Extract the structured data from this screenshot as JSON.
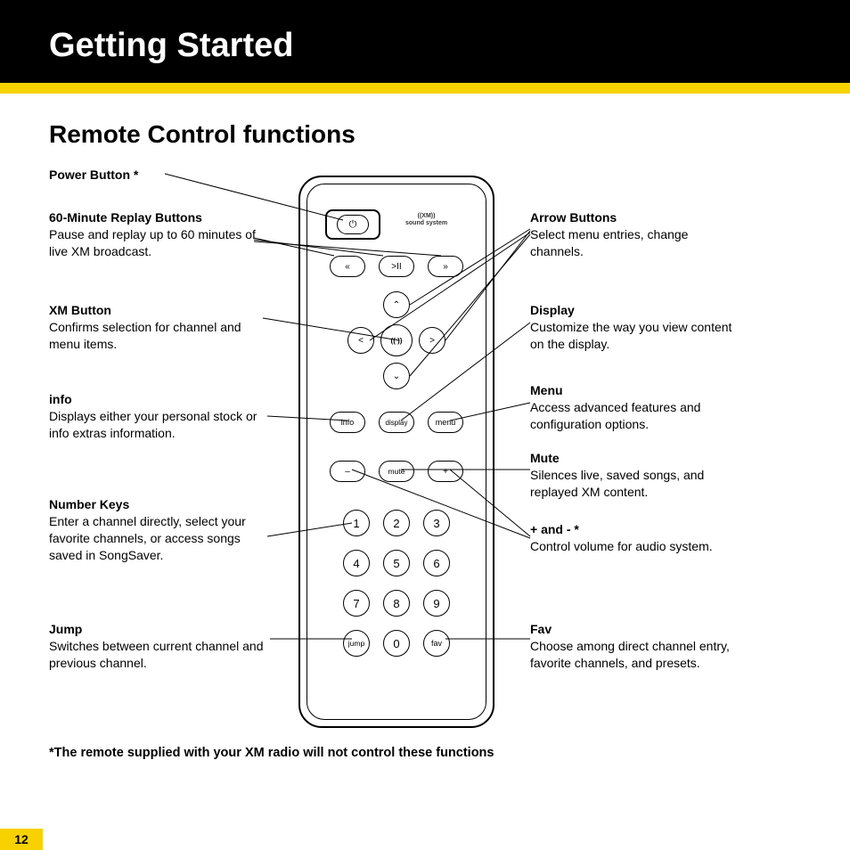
{
  "header": {
    "title": "Getting Started"
  },
  "subtitle": "Remote Control functions",
  "left_labels": [
    {
      "title": "Power Button *",
      "desc": ""
    },
    {
      "title": "60-Minute Replay Buttons",
      "desc": "Pause and replay up to 60 minutes of live XM broadcast."
    },
    {
      "title": "XM Button",
      "desc": "Confirms selection for channel and menu items."
    },
    {
      "title": "info",
      "desc": "Displays either your personal stock or info extras information."
    },
    {
      "title": "Number Keys",
      "desc": "Enter a channel directly, select your favorite channels, or access songs saved in SongSaver."
    },
    {
      "title": "Jump",
      "desc": "Switches between current channel and previous channel."
    }
  ],
  "right_labels": [
    {
      "title": "Arrow Buttons",
      "desc": "Select menu entries, change channels."
    },
    {
      "title": "Display",
      "desc": "Customize the way you view content on the display."
    },
    {
      "title": "Menu",
      "desc": "Access advanced features and configuration options."
    },
    {
      "title": "Mute",
      "desc": "Silences live, saved songs, and replayed XM content."
    },
    {
      "title": "+ and - *",
      "desc": "Control volume for audio system."
    },
    {
      "title": "Fav",
      "desc": "Choose among direct channel entry, favorite channels, and presets."
    }
  ],
  "remote": {
    "brand_top": "((XM))",
    "brand_bottom": "sound system",
    "power": "⏻",
    "replay": {
      "back": "«",
      "play": ">II",
      "fwd": "»"
    },
    "arrows": {
      "up": "⌃",
      "down": "⌄",
      "left": "<",
      "right": ">"
    },
    "xm_center": "((  ))",
    "info": "info",
    "display": "display",
    "menu": "menu",
    "minus": "–",
    "mute": "mute",
    "plus": "+",
    "jump": "jump",
    "fav": "fav",
    "numbers": [
      "1",
      "2",
      "3",
      "4",
      "5",
      "6",
      "7",
      "8",
      "9",
      "0"
    ]
  },
  "footnote": "*The remote supplied with your XM radio will not control these functions",
  "page_number": "12"
}
